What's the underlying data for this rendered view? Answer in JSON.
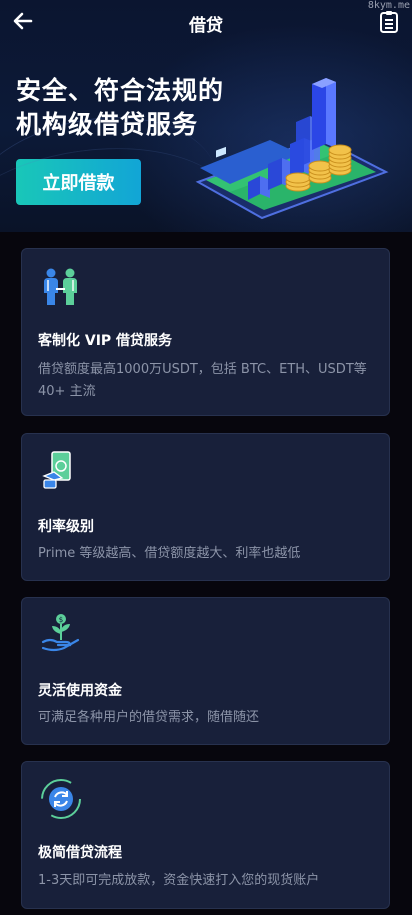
{
  "watermark": "8kym.me",
  "header": {
    "title": "借贷",
    "back_icon": "back-arrow-icon",
    "records_icon": "document-list-icon"
  },
  "hero": {
    "headline_line1": "安全、符合法规的",
    "headline_line2": "机构级借贷服务",
    "cta_label": "立即借款"
  },
  "features": [
    {
      "icon": "people-icon",
      "title": "客制化 VIP 借贷服务",
      "desc": "借贷额度最高1000万USDT，包括 BTC、ETH、USDT等40+ 主流"
    },
    {
      "icon": "cash-hand-icon",
      "title": "利率级别",
      "desc": "Prime 等级越高、借贷额度越大、利率也越低"
    },
    {
      "icon": "sprout-hand-icon",
      "title": "灵活使用资金",
      "desc": "可满足各种用户的借贷需求，随借随还"
    },
    {
      "icon": "refresh-cycle-icon",
      "title": "极简借贷流程",
      "desc": "1-3天即可完成放款，资金快速打入您的现货账户"
    }
  ],
  "colors": {
    "accent_start": "#19c7b8",
    "accent_end": "#12a5d6",
    "card_bg": "#18203a",
    "page_bg": "#07060d"
  }
}
